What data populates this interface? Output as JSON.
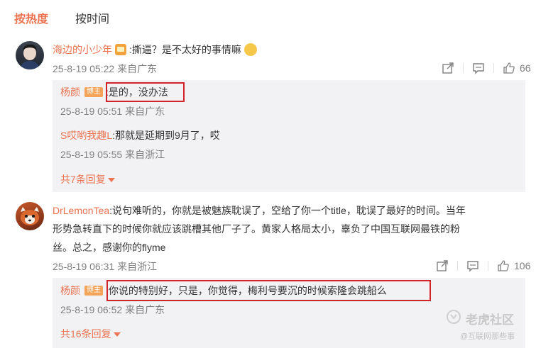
{
  "tabs": {
    "hot": "按热度",
    "time": "按时间"
  },
  "comments": [
    {
      "user": "海边的小少年",
      "text": ":撕逼？是不太好的事情嘛",
      "meta": "25-8-19 05:22 来自广东",
      "likes": "66",
      "replies": [
        {
          "user": "杨颜",
          "badge": "博主",
          "text": ":是的，没办法",
          "meta": "25-8-19 05:51 来自广东"
        },
        {
          "user": "S哎哟我趣L",
          "text": ":那就是延期到9月了，哎",
          "meta": "25-8-19 05:55 来自浙江"
        }
      ],
      "more": "共7条回复"
    },
    {
      "user": "DrLemonTea",
      "text_lines": [
        ":说句难听的，你就是被魅族耽误了，空给了你一个title，耽误了最好的时间。当年",
        "形势急转直下的时候你就应该跳槽其他厂子了。黄家人格局太小，辜负了中国互联网最铁的粉",
        "丝。总之，感谢你的flyme"
      ],
      "meta": "25-8-19 06:31 来自浙江",
      "likes": "106",
      "replies": [
        {
          "user": "杨颜",
          "badge": "博主",
          "text": ":你说的特别好，只是，你觉得，梅利号要沉的时候索隆会跳船么",
          "meta": "25-8-19 06:52 来自广东"
        }
      ],
      "more": "共16条回复"
    }
  ],
  "watermark": {
    "title": "老虎社区",
    "sub": "@互联网那些事"
  }
}
